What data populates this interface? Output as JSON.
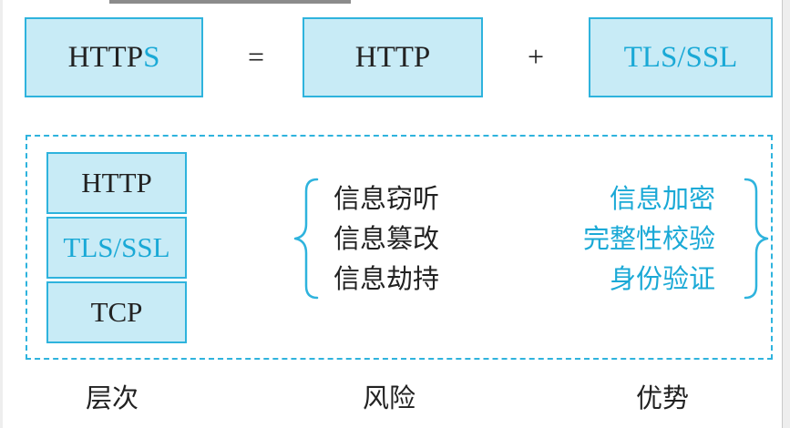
{
  "top_row": {
    "https_main": "HTTP",
    "https_suffix": "S",
    "equals": "=",
    "http": "HTTP",
    "plus": "+",
    "tls_ssl": "TLS/SSL"
  },
  "layers": [
    {
      "label": "HTTP"
    },
    {
      "label": "TLS/SSL"
    },
    {
      "label": "TCP"
    }
  ],
  "risks": [
    "信息窃听",
    "信息篡改",
    "信息劫持"
  ],
  "advantages": [
    "信息加密",
    "完整性校验",
    "身份验证"
  ],
  "footer": {
    "layers_label": "层次",
    "risks_label": "风险",
    "advantages_label": "优势"
  },
  "colors": {
    "accent": "#1aa9d6",
    "box_fill": "#c8ebf6",
    "box_border": "#2eb3dd",
    "text": "#222222"
  }
}
